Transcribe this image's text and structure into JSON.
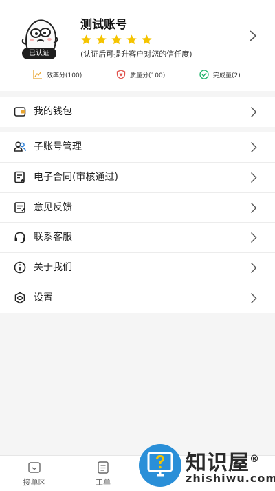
{
  "profile": {
    "name": "测试账号",
    "verified_badge": "已认证",
    "rating_stars": 5,
    "hint": "(认证后可提升客户对您的信任度)",
    "stats": [
      {
        "icon": "trend-chart-icon",
        "label": "效率分(100)"
      },
      {
        "icon": "shield-heart-icon",
        "label": "质量分(100)"
      },
      {
        "icon": "check-circle-icon",
        "label": "完成量(2)"
      }
    ]
  },
  "menu": {
    "wallet": "我的钱包",
    "items": [
      {
        "label": "子账号管理",
        "icon": "users-icon"
      },
      {
        "label": "电子合同(审核通过)",
        "icon": "contract-icon"
      },
      {
        "label": "意见反馈",
        "icon": "feedback-icon"
      },
      {
        "label": "联系客服",
        "icon": "headset-icon"
      },
      {
        "label": "关于我们",
        "icon": "info-icon"
      },
      {
        "label": "设置",
        "icon": "settings-icon"
      }
    ]
  },
  "tabbar": {
    "tabs": [
      {
        "label": "接单区",
        "icon": "inbox-icon"
      },
      {
        "label": "工单",
        "icon": "document-icon"
      },
      {
        "label": "",
        "icon": "unknown-icon"
      },
      {
        "label": "",
        "icon": "unknown-icon"
      }
    ]
  },
  "watermark": {
    "title": "知识屋",
    "subtitle": "zhishiwu.com",
    "registered": "®"
  },
  "colors": {
    "star": "#f5c400",
    "accent_green": "#1fb36a",
    "accent_red": "#e0504a",
    "watermark_blue": "#2a8fd8"
  }
}
